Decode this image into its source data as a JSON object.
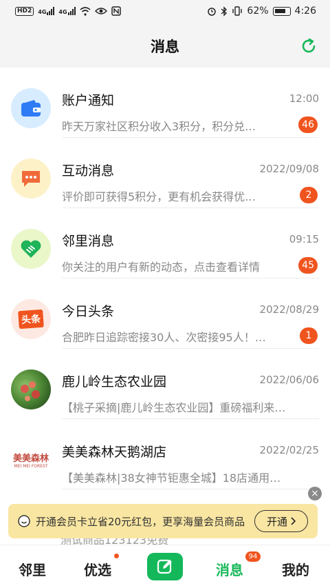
{
  "status_bar": {
    "left_chip_label": "HD",
    "left_chip_sub": "2",
    "signal_label_1": "4G",
    "signal_label_2": "4G",
    "battery_percent": "62%",
    "clock": "4:26"
  },
  "header": {
    "title": "消息"
  },
  "messages": [
    {
      "name": "账户通知",
      "time": "12:00",
      "preview": "昨天万家社区积分收入3积分，积分兑…",
      "badge": "46",
      "icon": "wallet-icon"
    },
    {
      "name": "互动消息",
      "time": "2022/09/08",
      "preview": "评价即可获得5积分，更有机会获得优…",
      "badge": "2",
      "icon": "chat-bubble-icon"
    },
    {
      "name": "邻里消息",
      "time": "09:15",
      "preview": "你关注的用户有新的动态，点击查看详情",
      "badge": "45",
      "icon": "heart-handshake-icon"
    },
    {
      "name": "今日头条",
      "time": "2022/08/29",
      "preview": "合肥昨日追踪密接30人、次密接95人！…",
      "badge": "1",
      "icon": "toutiao-logo-icon",
      "logo_text": "头条"
    },
    {
      "name": "鹿儿岭生态农业园",
      "time": "2022/06/06",
      "preview": "【桃子采摘|鹿儿岭生态农业园】重磅福利来…",
      "badge": "",
      "icon": "peach-photo-icon"
    },
    {
      "name": "美美森林天鹅湖店",
      "time": "2022/02/25",
      "preview": "【美美森林|38女神节钜惠全城】18店通用！…",
      "badge": "",
      "icon": "meimei-forest-logo-icon",
      "logo_text": "美美森林",
      "logo_sub": "MEI MEI FOREST"
    }
  ],
  "banner": {
    "text": "开通会员卡立省20元红包，更享海量会员商品",
    "button_label": "开通",
    "close_glyph": "×",
    "peek_text": "测试商品123123免费"
  },
  "tabs": [
    {
      "label": "邻里"
    },
    {
      "label": "优选"
    },
    {
      "label": "消息",
      "count": "94"
    },
    {
      "label": "我的"
    }
  ],
  "colors": {
    "accent_green": "#18b85a",
    "badge_red": "#f0541e",
    "banner_bg": "#f9e6a2"
  }
}
